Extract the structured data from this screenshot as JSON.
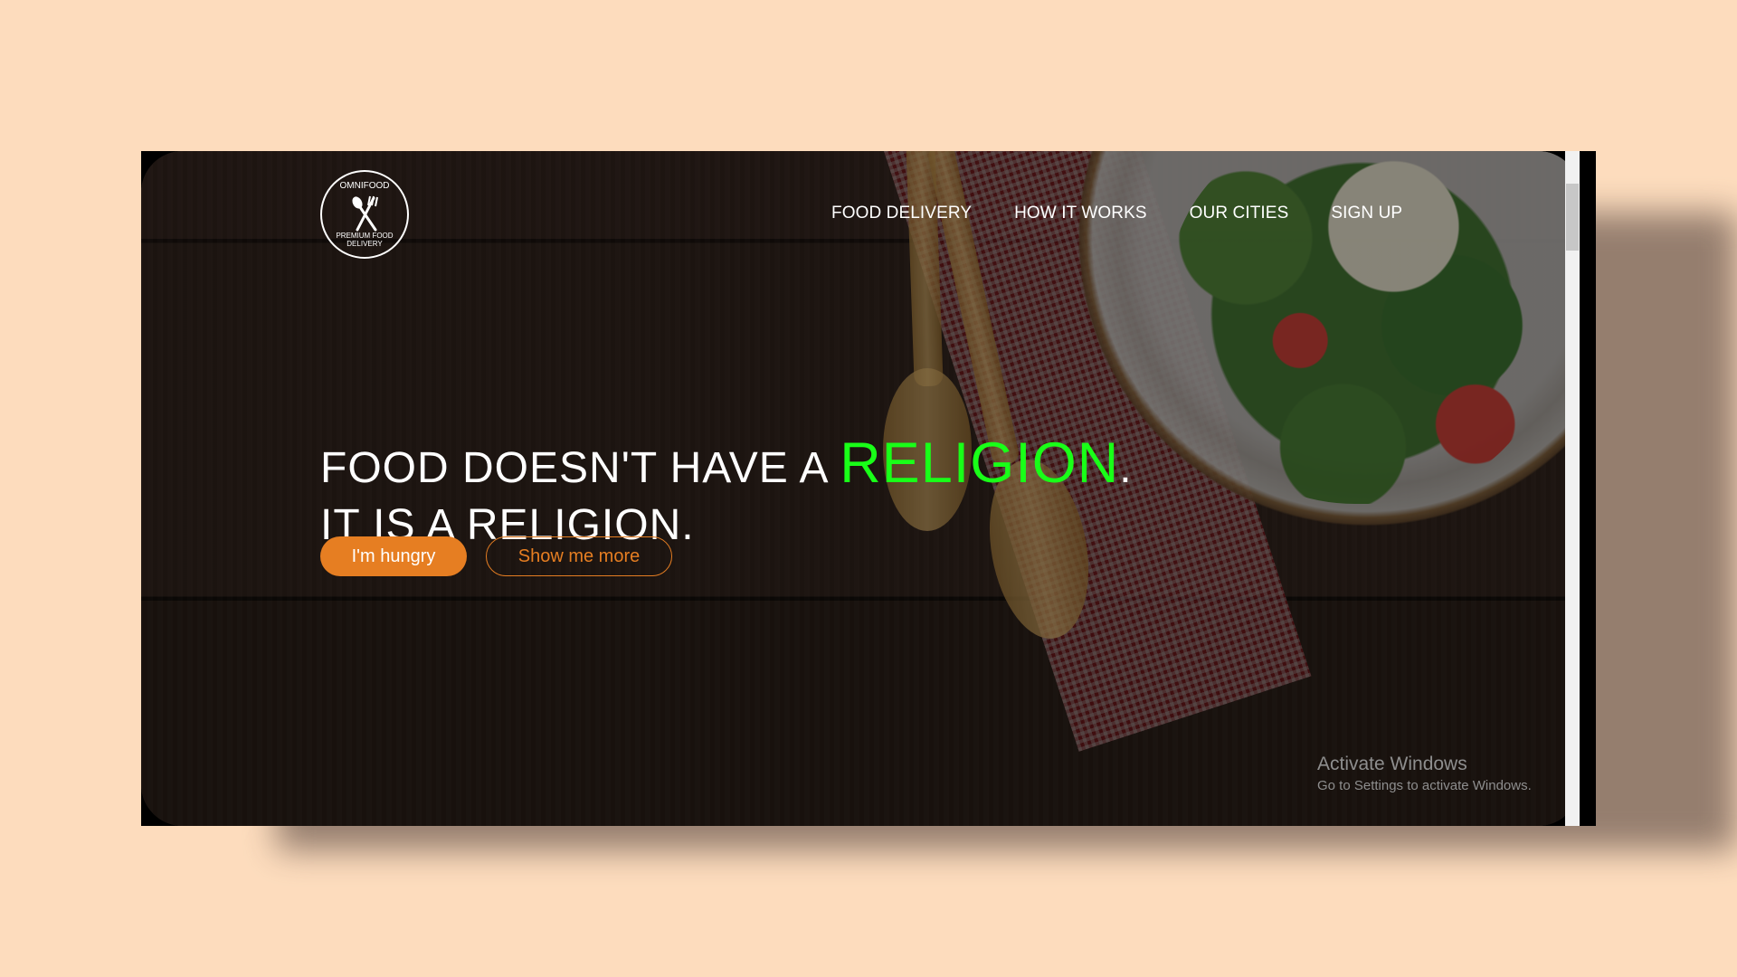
{
  "logo": {
    "top_text": "OMNIFOOD",
    "bottom_text": "PREMIUM FOOD DELIVERY",
    "icon": "fork-spoon-icon"
  },
  "nav": {
    "items": [
      "FOOD DELIVERY",
      "HOW IT WORKS",
      "OUR CITIES",
      "SIGN UP"
    ]
  },
  "hero": {
    "line1_prefix": "FOOD DOESN'T HAVE A ",
    "line1_highlight": "RELIGION",
    "line1_suffix": ".",
    "line2": "IT IS A RELIGION.",
    "highlight_color": "#19ff18"
  },
  "buttons": {
    "primary": "I'm hungry",
    "secondary": "Show me more",
    "accent": "#e67e22"
  },
  "watermark": {
    "title": "Activate Windows",
    "subtitle": "Go to Settings to activate Windows."
  }
}
